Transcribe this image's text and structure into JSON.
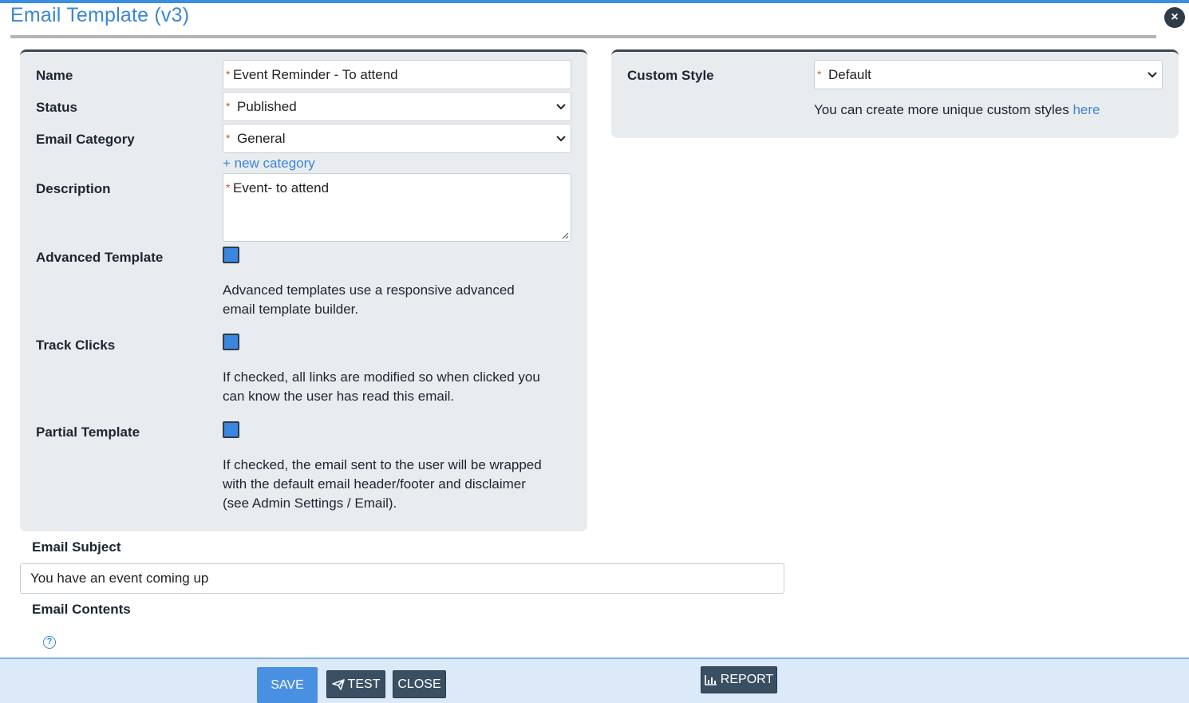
{
  "header": {
    "title": "Email Template (v3)",
    "close_glyph": "×"
  },
  "form": {
    "name": {
      "label": "Name",
      "value": "Event Reminder - To attend",
      "required_mark": "*"
    },
    "status": {
      "label": "Status",
      "value": "Published",
      "required_mark": "*"
    },
    "category": {
      "label": "Email Category",
      "value": "General",
      "required_mark": "*",
      "new_link": "+ new category"
    },
    "description": {
      "label": "Description",
      "value": "Event- to attend",
      "required_mark": "*"
    },
    "advanced": {
      "label": "Advanced Template",
      "checked": true,
      "help_line1": "Advanced templates use a responsive advanced",
      "help_line2": "email template builder."
    },
    "track": {
      "label": "Track Clicks",
      "checked": true,
      "help_line1": "If checked, all links are modified so when clicked you",
      "help_line2": "can know the user has read this email."
    },
    "partial": {
      "label": "Partial Template",
      "checked": true,
      "help_line1": "If checked, the email sent to the user will be wrapped",
      "help_line2": "with the default email header/footer and disclaimer",
      "help_line3": "(see Admin Settings / Email)."
    },
    "custom_style": {
      "label": "Custom Style",
      "value": "Default",
      "required_mark": "*",
      "help_text": "You can create more unique custom styles ",
      "help_link": "here"
    },
    "subject": {
      "label": "Email Subject",
      "value": "You have an event coming up"
    },
    "contents": {
      "label": "Email Contents",
      "help_icon": "?"
    }
  },
  "actions": {
    "save": "SAVE",
    "test": "TEST",
    "close": "CLOSE",
    "report": "REPORT"
  },
  "colors": {
    "accent": "#3a86d6",
    "panel_bg": "#e9ecef",
    "dark_button": "#3b4f63",
    "required": "#e04b3a",
    "checkbox": "#3b86e0"
  },
  "icons": {
    "close": "close-icon",
    "dropdown": "chevron-down-icon",
    "help": "question-circle-icon",
    "test": "paper-plane-icon",
    "report": "bar-chart-icon"
  }
}
